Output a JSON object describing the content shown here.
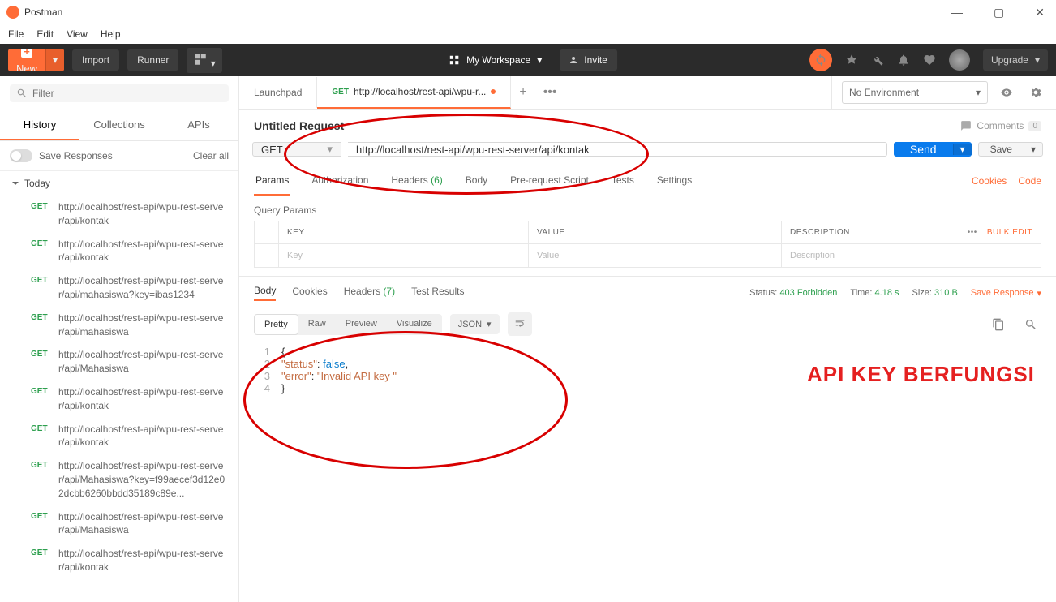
{
  "window": {
    "title": "Postman"
  },
  "menubar": [
    "File",
    "Edit",
    "View",
    "Help"
  ],
  "toolbar": {
    "new_label": "New",
    "import_label": "Import",
    "runner_label": "Runner",
    "workspace_label": "My Workspace",
    "invite_label": "Invite",
    "upgrade_label": "Upgrade"
  },
  "sidebar": {
    "filter_placeholder": "Filter",
    "tabs": [
      "History",
      "Collections",
      "APIs"
    ],
    "active_tab": 0,
    "save_responses_label": "Save Responses",
    "clear_all_label": "Clear all",
    "day_label": "Today",
    "history": [
      {
        "method": "GET",
        "url": "http://localhost/rest-api/wpu-rest-server/api/kontak"
      },
      {
        "method": "GET",
        "url": "http://localhost/rest-api/wpu-rest-server/api/kontak"
      },
      {
        "method": "GET",
        "url": "http://localhost/rest-api/wpu-rest-server/api/mahasiswa?key=ibas1234"
      },
      {
        "method": "GET",
        "url": "http://localhost/rest-api/wpu-rest-server/api/mahasiswa"
      },
      {
        "method": "GET",
        "url": "http://localhost/rest-api/wpu-rest-server/api/Mahasiswa"
      },
      {
        "method": "GET",
        "url": "http://localhost/rest-api/wpu-rest-server/api/kontak"
      },
      {
        "method": "GET",
        "url": "http://localhost/rest-api/wpu-rest-server/api/kontak"
      },
      {
        "method": "GET",
        "url": "http://localhost/rest-api/wpu-rest-server/api/Mahasiswa?key=f99aecef3d12e02dcbb6260bbdd35189c89e..."
      },
      {
        "method": "GET",
        "url": "http://localhost/rest-api/wpu-rest-server/api/Mahasiswa"
      },
      {
        "method": "GET",
        "url": "http://localhost/rest-api/wpu-rest-server/api/kontak"
      }
    ]
  },
  "tabs": [
    {
      "label": "Launchpad"
    },
    {
      "method": "GET",
      "label": "http://localhost/rest-api/wpu-r...",
      "active": true,
      "dirty": true
    }
  ],
  "environment": {
    "label": "No Environment"
  },
  "request": {
    "title": "Untitled Request",
    "method": "GET",
    "url": "http://localhost/rest-api/wpu-rest-server/api/kontak",
    "send_label": "Send",
    "save_label": "Save",
    "comments_label": "Comments",
    "comments_count": "0",
    "tabs": [
      {
        "label": "Params",
        "active": true
      },
      {
        "label": "Authorization"
      },
      {
        "label": "Headers",
        "count": "(6)"
      },
      {
        "label": "Body"
      },
      {
        "label": "Pre-request Script"
      },
      {
        "label": "Tests"
      },
      {
        "label": "Settings"
      }
    ],
    "links": {
      "cookies": "Cookies",
      "code": "Code"
    },
    "params_title": "Query Params",
    "columns": {
      "key": "KEY",
      "value": "VALUE",
      "desc": "DESCRIPTION",
      "bulk": "Bulk Edit"
    },
    "placeholders": {
      "key": "Key",
      "value": "Value",
      "desc": "Description"
    }
  },
  "response": {
    "tabs": [
      {
        "label": "Body",
        "active": true
      },
      {
        "label": "Cookies"
      },
      {
        "label": "Headers",
        "count": "(7)"
      },
      {
        "label": "Test Results"
      }
    ],
    "status_label": "Status:",
    "status_value": "403 Forbidden",
    "time_label": "Time:",
    "time_value": "4.18 s",
    "size_label": "Size:",
    "size_value": "310 B",
    "save_response_label": "Save Response",
    "views": [
      "Pretty",
      "Raw",
      "Preview",
      "Visualize"
    ],
    "active_view": 0,
    "format": "JSON",
    "body_lines": [
      {
        "n": "1",
        "text": "{"
      },
      {
        "n": "2",
        "html": "    <span class='str'>\"status\"</span>: <span class='bool'>false</span>,"
      },
      {
        "n": "3",
        "html": "    <span class='str'>\"error\"</span>: <span class='str'>\"Invalid API key \"</span>"
      },
      {
        "n": "4",
        "text": "}"
      }
    ]
  },
  "annotation": {
    "text": "API KEY BERFUNGSI"
  }
}
